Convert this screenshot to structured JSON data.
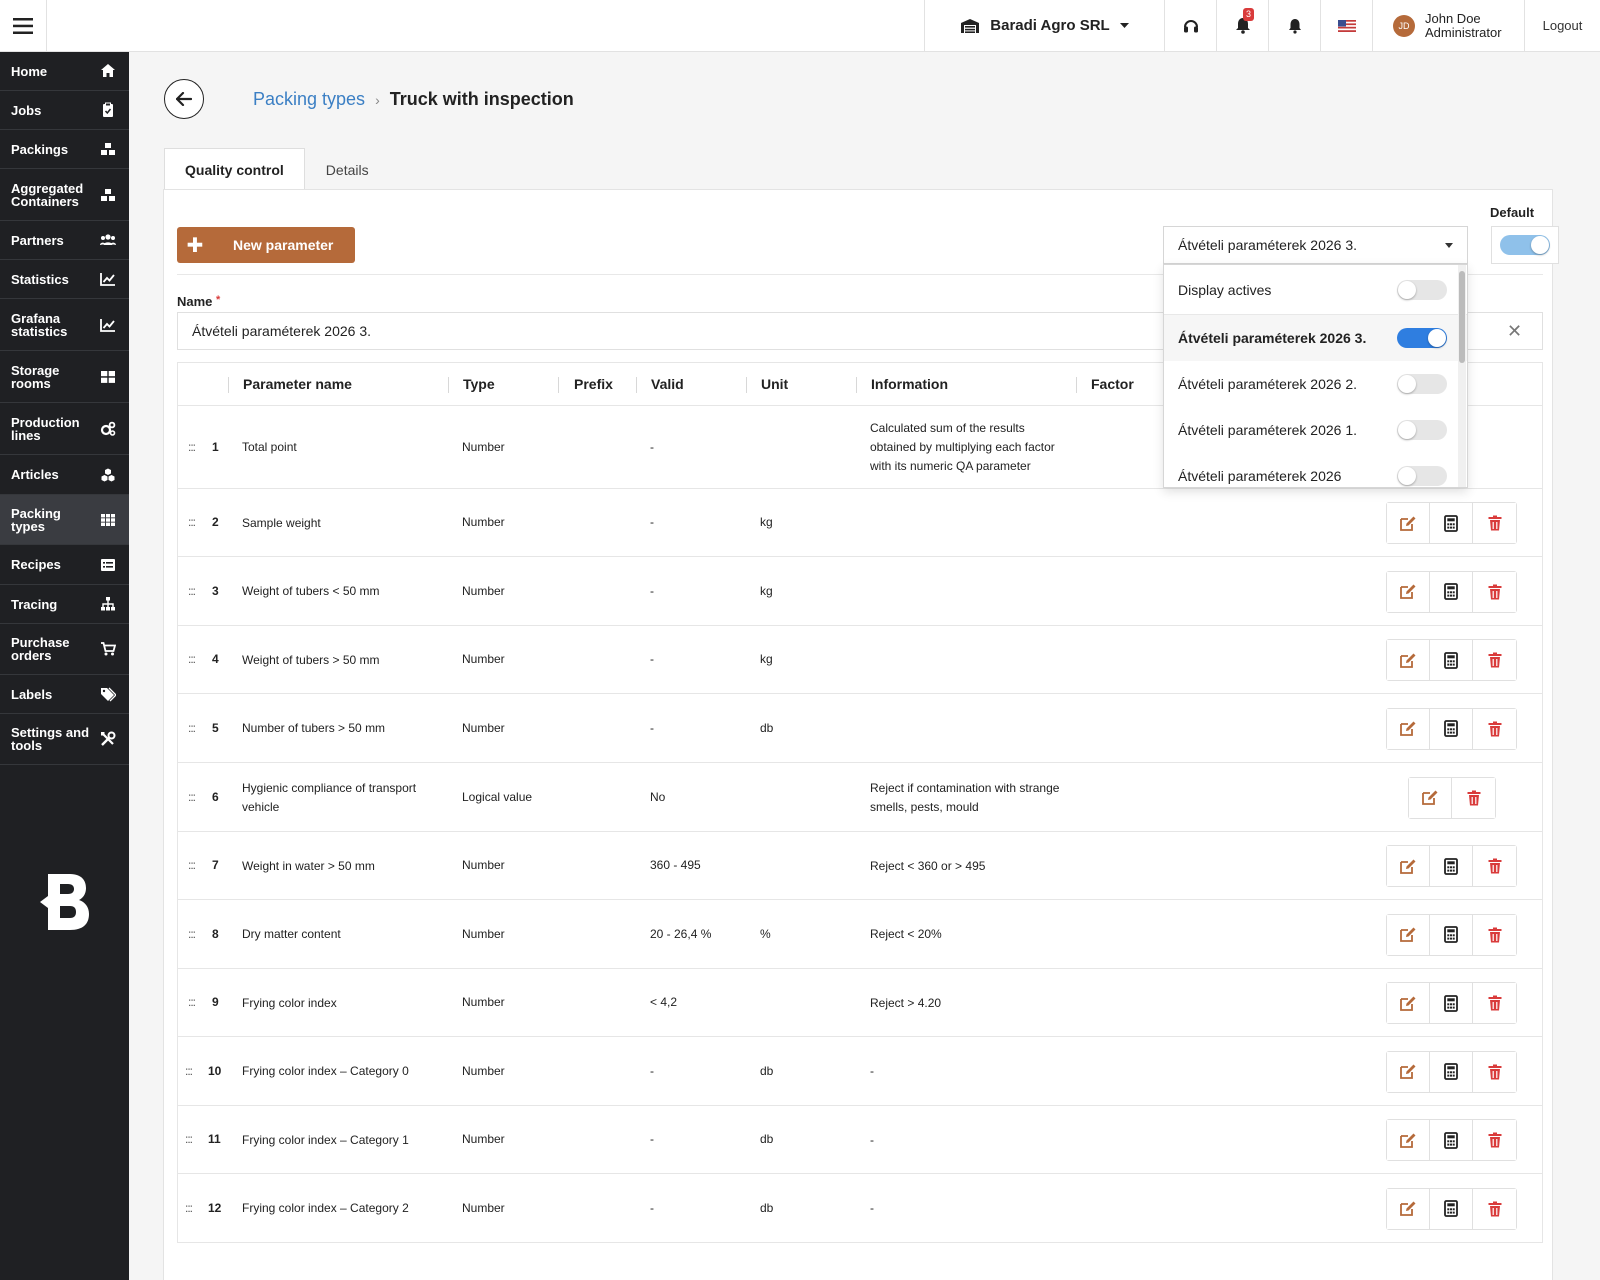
{
  "topbar": {
    "company": "Baradi Agro SRL",
    "notification_count": "3",
    "user_initials": "JD",
    "user_name": "John Doe",
    "user_role": "Administrator",
    "logout": "Logout"
  },
  "sidebar": {
    "items": [
      {
        "label": "Home",
        "icon": "home-icon"
      },
      {
        "label": "Jobs",
        "icon": "clipboard-icon"
      },
      {
        "label": "Packings",
        "icon": "boxes-icon"
      },
      {
        "label": "Aggregated Containers",
        "icon": "boxes-icon"
      },
      {
        "label": "Partners",
        "icon": "users-icon"
      },
      {
        "label": "Statistics",
        "icon": "chart-line-icon"
      },
      {
        "label": "Grafana statistics",
        "icon": "chart-line-icon"
      },
      {
        "label": "Storage rooms",
        "icon": "grid-icon"
      },
      {
        "label": "Production lines",
        "icon": "cogs-icon"
      },
      {
        "label": "Articles",
        "icon": "cubes-icon"
      },
      {
        "label": "Packing types",
        "icon": "th-icon",
        "active": true
      },
      {
        "label": "Recipes",
        "icon": "list-icon"
      },
      {
        "label": "Tracing",
        "icon": "sitemap-icon"
      },
      {
        "label": "Purchase orders",
        "icon": "cart-icon"
      },
      {
        "label": "Labels",
        "icon": "tags-icon"
      },
      {
        "label": "Settings and tools",
        "icon": "tools-icon"
      }
    ]
  },
  "breadcrumb": {
    "parent": "Packing types",
    "current": "Truck with inspection"
  },
  "tabs": [
    "Quality control",
    "Details"
  ],
  "toolbar": {
    "new_parameter": "New parameter",
    "default_label": "Default"
  },
  "form": {
    "name_label": "Name",
    "name_required": "*",
    "name_value": "Átvételi paraméterek 2026 3."
  },
  "select": {
    "value": "Átvételi paraméterek 2026 3.",
    "display_actives": "Display actives",
    "options": [
      {
        "label": "Átvételi paraméterek 2026 3.",
        "active": true,
        "selected": true
      },
      {
        "label": "Átvételi paraméterek 2026 2.",
        "active": false
      },
      {
        "label": "Átvételi paraméterek 2026 1.",
        "active": false
      },
      {
        "label": "Átvételi paraméterek 2026",
        "active": false
      }
    ]
  },
  "table": {
    "headers": [
      "Parameter name",
      "Type",
      "Prefix",
      "Valid",
      "Unit",
      "Information",
      "Factor"
    ],
    "rows": [
      {
        "num": "1",
        "name": [
          "Total point"
        ],
        "type": "Number",
        "prefix": "",
        "valid": "-",
        "unit": "",
        "info": [
          "Calculated sum of the results",
          "obtained by multiplying each factor",
          "with its numeric QA parameter"
        ],
        "actions": "none"
      },
      {
        "num": "2",
        "name": [
          "Sample weight"
        ],
        "type": "Number",
        "prefix": "",
        "valid": "-",
        "unit": "kg",
        "info": [],
        "actions": "full"
      },
      {
        "num": "3",
        "name": [
          "Weight of tubers < 50 mm"
        ],
        "type": "Number",
        "prefix": "",
        "valid": "-",
        "unit": "kg",
        "info": [],
        "actions": "full"
      },
      {
        "num": "4",
        "name": [
          "Weight of tubers > 50 mm"
        ],
        "type": "Number",
        "prefix": "",
        "valid": "-",
        "unit": "kg",
        "info": [],
        "actions": "full"
      },
      {
        "num": "5",
        "name": [
          "Number of tubers > 50 mm"
        ],
        "type": "Number",
        "prefix": "",
        "valid": "-",
        "unit": "db",
        "info": [],
        "actions": "full"
      },
      {
        "num": "6",
        "name": [
          "Hygienic compliance of transport",
          "vehicle"
        ],
        "type": "Logical value",
        "prefix": "",
        "valid": "No",
        "unit": "",
        "info": [
          "Reject if contamination with strange",
          "smells, pests, mould"
        ],
        "actions": "short"
      },
      {
        "num": "7",
        "name": [
          "Weight in water > 50 mm"
        ],
        "type": "Number",
        "prefix": "",
        "valid": "360 - 495",
        "unit": "",
        "info": [
          "Reject < 360 or > 495"
        ],
        "actions": "full"
      },
      {
        "num": "8",
        "name": [
          "Dry matter content"
        ],
        "type": "Number",
        "prefix": "",
        "valid": "20 - 26,4 %",
        "unit": "%",
        "info": [
          "Reject < 20%"
        ],
        "actions": "full"
      },
      {
        "num": "9",
        "name": [
          "Frying color index"
        ],
        "type": "Number",
        "prefix": "",
        "valid": "< 4,2",
        "unit": "",
        "info": [
          "Reject > 4.20"
        ],
        "actions": "full"
      },
      {
        "num": "10",
        "name": [
          "Frying color index – Category 0"
        ],
        "type": "Number",
        "prefix": "",
        "valid": "-",
        "unit": "db",
        "info": [
          "-"
        ],
        "actions": "full"
      },
      {
        "num": "11",
        "name": [
          "Frying color index – Category 1"
        ],
        "type": "Number",
        "prefix": "",
        "valid": "-",
        "unit": "db",
        "info": [
          "-"
        ],
        "actions": "full"
      },
      {
        "num": "12",
        "name": [
          "Frying color index – Category 2"
        ],
        "type": "Number",
        "prefix": "",
        "valid": "-",
        "unit": "db",
        "info": [
          "-"
        ],
        "actions": "full"
      }
    ]
  },
  "colors": {
    "accent": "#b56a3a",
    "link": "#3b7fc4",
    "danger": "#d93b3b",
    "toggle_on": "#2f7ee0",
    "sidebar_bg": "#1f2023"
  }
}
